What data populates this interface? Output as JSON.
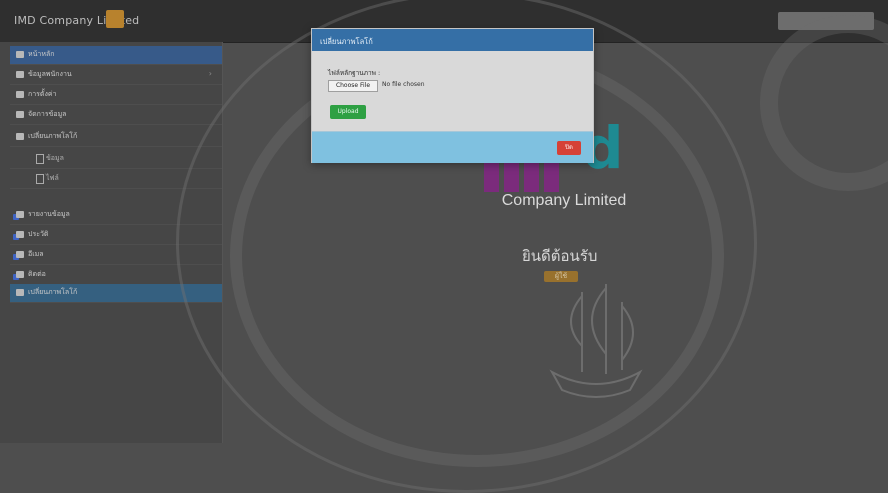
{
  "app": {
    "brand": "IMD Company Limited"
  },
  "sidebar": {
    "items": [
      {
        "label": "หน้าหลัก"
      },
      {
        "label": "ข้อมูลพนักงาน"
      },
      {
        "label": "การตั้งค่า"
      },
      {
        "label": "จัดการข้อมูล"
      },
      {
        "label": "เปลี่ยนภาพโลโก้"
      },
      {
        "label": "ข้อมูล"
      },
      {
        "label": "ไฟล์"
      },
      {
        "label": "รายงานข้อมูล"
      },
      {
        "label": "ประวัติ"
      },
      {
        "label": "อีเมล"
      },
      {
        "label": "ติดต่อ"
      },
      {
        "label": "เปลี่ยนภาพโลโก้"
      }
    ]
  },
  "content": {
    "logo_letter": "d",
    "company_name": "Company Limited",
    "welcome": "ยินดีต้อนรับ",
    "badge": "ผู้ใช้"
  },
  "modal": {
    "title": "เปลี่ยนภาพโลโก้",
    "file_label": "ไฟล์หลักฐานภาพ :",
    "file_button": "Choose File",
    "file_status": "No file chosen",
    "upload_button": "Upload",
    "close_button": "ปิด"
  },
  "colors": {
    "modal_header": "#356fa6",
    "upload": "#2ea043",
    "close": "#d54136",
    "sidebar_active": "#356080"
  }
}
